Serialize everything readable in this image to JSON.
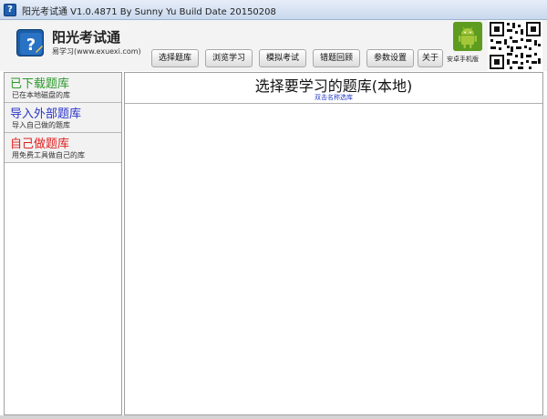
{
  "window": {
    "title": "阳光考试通 V1.0.4871 By Sunny Yu  Build Date 20150208"
  },
  "header": {
    "app_name": "阳光考试通",
    "app_sub": "易学习(www.exuexi.com)",
    "buttons": [
      {
        "label": "选择题库"
      },
      {
        "label": "浏览学习"
      },
      {
        "label": "模拟考试"
      },
      {
        "label": "错题回顾"
      },
      {
        "label": "参数设置"
      },
      {
        "label": "关于"
      }
    ],
    "android_label": "安卓手机版"
  },
  "sidebar": {
    "items": [
      {
        "title": "已下载题库",
        "desc": "已在本地磁盘的库",
        "color": "#2a9a2a"
      },
      {
        "title": "导入外部题库",
        "desc": "导入自己做的题库",
        "color": "#2a35c8"
      },
      {
        "title": "自己做题库",
        "desc": "用免费工具做自己的库",
        "color": "#e02020"
      }
    ]
  },
  "main": {
    "title": "选择要学习的题库(本地)",
    "hint": "双击名称选库"
  }
}
